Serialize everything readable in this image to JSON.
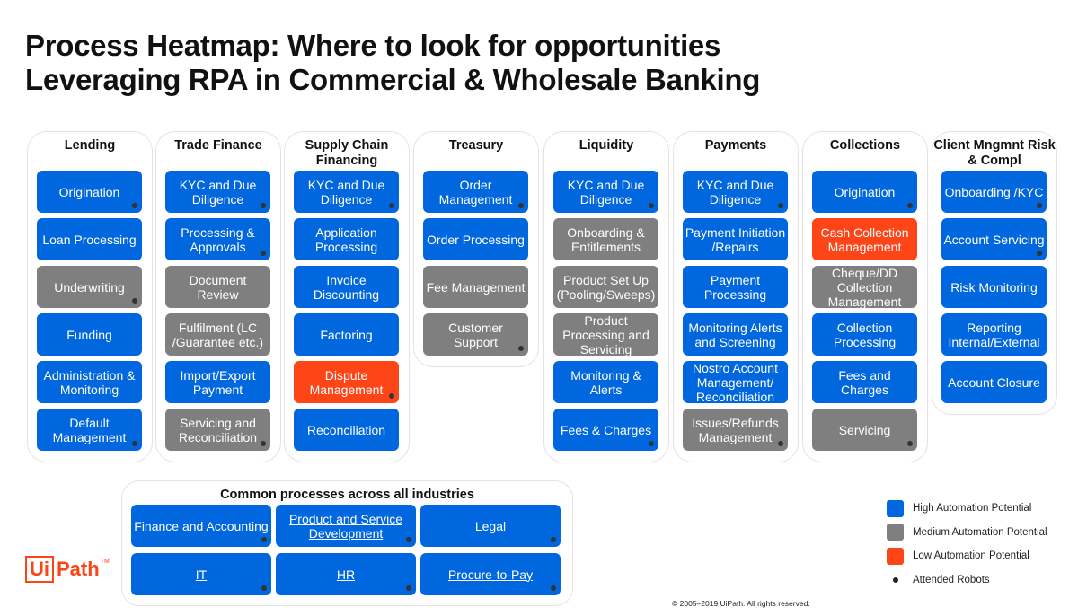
{
  "title": {
    "line1": "Process Heatmap: Where to look for opportunities",
    "line2": "Leveraging RPA in Commercial & Wholesale Banking"
  },
  "columns": [
    {
      "heading": "Lending",
      "items": [
        {
          "label": "Origination",
          "level": "high",
          "attended": true
        },
        {
          "label": "Loan Processing",
          "level": "high",
          "attended": false
        },
        {
          "label": "Underwriting",
          "level": "medium",
          "attended": true
        },
        {
          "label": "Funding",
          "level": "high",
          "attended": false
        },
        {
          "label": "Administration & Monitoring",
          "level": "high",
          "attended": false
        },
        {
          "label": "Default Management",
          "level": "high",
          "attended": true
        }
      ]
    },
    {
      "heading": "Trade Finance",
      "items": [
        {
          "label": "KYC and Due Diligence",
          "level": "high",
          "attended": true
        },
        {
          "label": "Processing & Approvals",
          "level": "high",
          "attended": true
        },
        {
          "label": "Document Review",
          "level": "medium",
          "attended": false
        },
        {
          "label": "Fulfilment (LC /Guarantee etc.)",
          "level": "medium",
          "attended": false
        },
        {
          "label": "Import/Export Payment",
          "level": "high",
          "attended": false
        },
        {
          "label": "Servicing and Reconciliation",
          "level": "medium",
          "attended": true
        }
      ]
    },
    {
      "heading": "Supply Chain Financing",
      "items": [
        {
          "label": "KYC and Due Diligence",
          "level": "high",
          "attended": true
        },
        {
          "label": "Application Processing",
          "level": "high",
          "attended": false
        },
        {
          "label": "Invoice Discounting",
          "level": "high",
          "attended": false
        },
        {
          "label": "Factoring",
          "level": "high",
          "attended": false
        },
        {
          "label": "Dispute Management",
          "level": "low",
          "attended": true
        },
        {
          "label": "Reconciliation",
          "level": "high",
          "attended": false
        }
      ]
    },
    {
      "heading": "Treasury",
      "items": [
        {
          "label": "Order Management",
          "level": "high",
          "attended": true
        },
        {
          "label": "Order Processing",
          "level": "high",
          "attended": false
        },
        {
          "label": "Fee Management",
          "level": "medium",
          "attended": false
        },
        {
          "label": "Customer Support",
          "level": "medium",
          "attended": true
        }
      ]
    },
    {
      "heading": "Liquidity",
      "items": [
        {
          "label": "KYC and Due Diligence",
          "level": "high",
          "attended": true
        },
        {
          "label": "Onboarding & Entitlements",
          "level": "medium",
          "attended": false
        },
        {
          "label": "Product Set Up (Pooling/Sweeps)",
          "level": "medium",
          "attended": false
        },
        {
          "label": "Product Processing and Servicing",
          "level": "medium",
          "attended": false
        },
        {
          "label": "Monitoring & Alerts",
          "level": "high",
          "attended": false
        },
        {
          "label": "Fees & Charges",
          "level": "high",
          "attended": true
        }
      ]
    },
    {
      "heading": "Payments",
      "items": [
        {
          "label": "KYC and Due Diligence",
          "level": "high",
          "attended": true
        },
        {
          "label": "Payment Initiation /Repairs",
          "level": "high",
          "attended": false
        },
        {
          "label": "Payment Processing",
          "level": "high",
          "attended": false
        },
        {
          "label": "Monitoring Alerts and Screening",
          "level": "high",
          "attended": false
        },
        {
          "label": "Nostro Account Management/ Reconciliation",
          "level": "high",
          "attended": false
        },
        {
          "label": "Issues/Refunds Management",
          "level": "medium",
          "attended": true
        }
      ]
    },
    {
      "heading": "Collections",
      "items": [
        {
          "label": "Origination",
          "level": "high",
          "attended": true
        },
        {
          "label": "Cash Collection Management",
          "level": "low",
          "attended": false
        },
        {
          "label": "Cheque/DD Collection Management",
          "level": "medium",
          "attended": false
        },
        {
          "label": "Collection Processing",
          "level": "high",
          "attended": false
        },
        {
          "label": "Fees and Charges",
          "level": "high",
          "attended": false
        },
        {
          "label": "Servicing",
          "level": "medium",
          "attended": true
        }
      ]
    },
    {
      "heading": "Client Mngmnt Risk & Compl",
      "items": [
        {
          "label": "Onboarding /KYC",
          "level": "high",
          "attended": true
        },
        {
          "label": "Account Servicing",
          "level": "high",
          "attended": true
        },
        {
          "label": "Risk Monitoring",
          "level": "high",
          "attended": false
        },
        {
          "label": "Reporting Internal/External",
          "level": "high",
          "attended": false
        },
        {
          "label": "Account Closure",
          "level": "high",
          "attended": false
        }
      ]
    }
  ],
  "common": {
    "heading": "Common processes across all industries",
    "items": [
      {
        "label": "Finance and Accounting",
        "attended": true
      },
      {
        "label": "Product and Service Development",
        "attended": true
      },
      {
        "label": "Legal",
        "attended": true
      },
      {
        "label": "IT",
        "attended": true
      },
      {
        "label": "HR",
        "attended": true
      },
      {
        "label": "Procure-to-Pay",
        "attended": true
      }
    ]
  },
  "legend": {
    "high": "High Automation Potential",
    "medium": "Medium Automation Potential",
    "low": "Low Automation Potential",
    "attended": "Attended Robots"
  },
  "colors": {
    "high": "#0067df",
    "medium": "#7f7f7f",
    "low": "#fe4518",
    "brand": "#fa4616"
  },
  "logo": {
    "ui": "Ui",
    "path": "Path",
    "tm": "TM"
  },
  "copyright": "© 2005–2019 UiPath. All rights reserved."
}
